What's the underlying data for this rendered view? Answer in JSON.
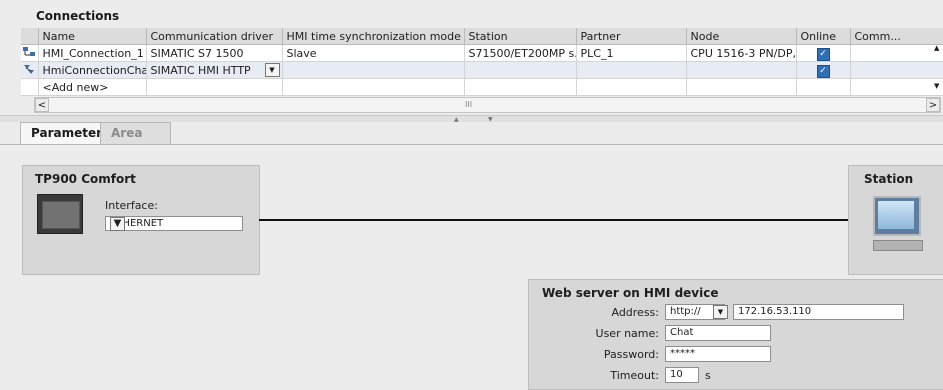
{
  "connections": {
    "title": "Connections",
    "columns": [
      "Name",
      "Communication driver",
      "HMI time synchronization mode",
      "Station",
      "Partner",
      "Node",
      "Online",
      "Comm..."
    ],
    "rows": [
      {
        "icon": "hmi-connection-icon",
        "name": "HMI_Connection_1",
        "driver": "SIMATIC S7 1500",
        "sync": "Slave",
        "station": "S71500/ET200MP s...",
        "partner": "PLC_1",
        "node": "CPU 1516-3 PN/DP,...",
        "online": true,
        "comm": ""
      },
      {
        "icon": "hmi-chat-connection-icon",
        "name": "HmiConnectionChat",
        "driver": "SIMATIC HMI HTTP",
        "sync": "",
        "station": "",
        "partner": "",
        "node": "",
        "online": true,
        "comm": ""
      }
    ],
    "add_new": "<Add new>",
    "scroll_left": "<",
    "scroll_right": ">",
    "scroll_grip": "III"
  },
  "tabs": {
    "parameter": "Parameter",
    "area_pointer": "Area pointer"
  },
  "device": {
    "title": "TP900 Comfort",
    "interface_label": "Interface:",
    "interface_value": "ETHERNET"
  },
  "station": {
    "title": "Station"
  },
  "web_server": {
    "title": "Web server on HMI device",
    "address_label": "Address:",
    "protocol": "http://",
    "address": "172.16.53.110",
    "username_label": "User name:",
    "username": "Chat",
    "password_label": "Password:",
    "password": "*****",
    "timeout_label": "Timeout:",
    "timeout": "10",
    "timeout_unit": "s"
  },
  "colors": {
    "checkbox": "#2f6fb5",
    "selected_row": "#e6ebf4",
    "panel": "#d7d7d7"
  }
}
